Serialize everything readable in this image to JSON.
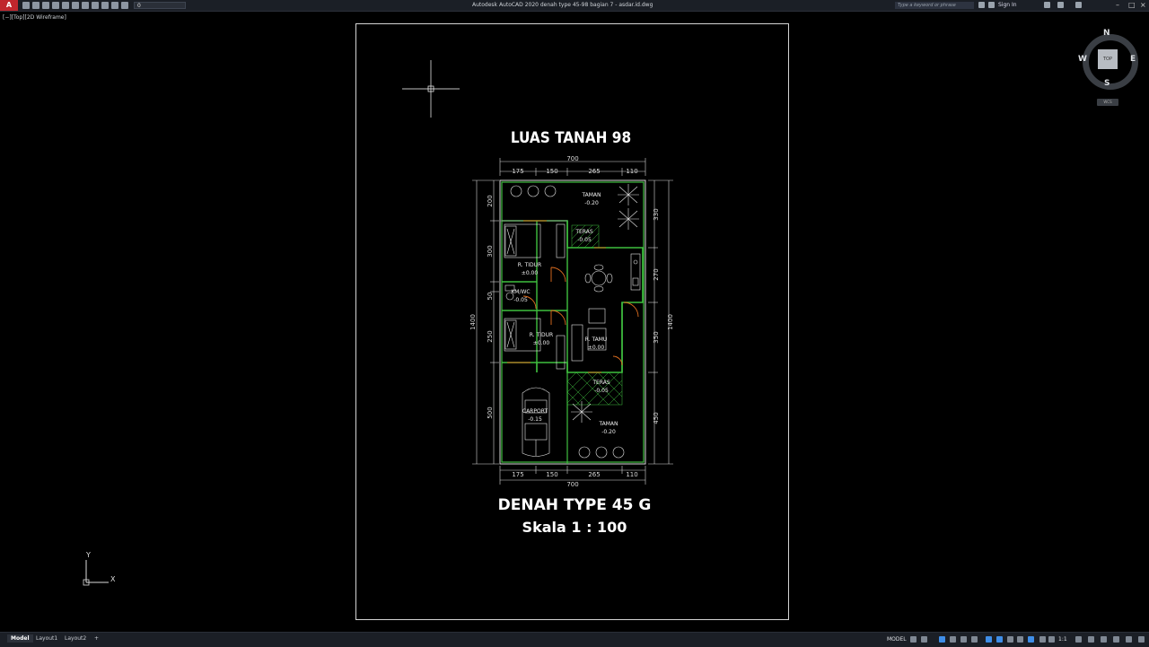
{
  "window": {
    "title": "Autodesk AutoCAD 2020    denah type 45-98 bagian 7 - asdar.id.dwg",
    "search_placeholder": "Type a keyword or phrase",
    "sign_in": "Sign In",
    "layer": "0",
    "logo": "A"
  },
  "viewport": {
    "label": "[−][Top][2D Wireframe]"
  },
  "compass": {
    "n": "N",
    "s": "S",
    "e": "E",
    "w": "W",
    "top": "TOP",
    "wcs": "WCS"
  },
  "ucs": {
    "x": "X",
    "y": "Y"
  },
  "drawing": {
    "title_top": "LUAS TANAH 98",
    "title_bottom": "DENAH TYPE 45 G",
    "scale": "Skala 1 : 100",
    "dims_top": [
      "700",
      "175",
      "150",
      "265",
      "110"
    ],
    "dims_bottom": [
      "175",
      "150",
      "265",
      "110",
      "700"
    ],
    "dims_left": [
      "200",
      "300",
      "50",
      "250",
      "500",
      "1400"
    ],
    "dims_right": [
      "330",
      "270",
      "350",
      "450",
      "1400"
    ],
    "rooms": [
      {
        "name": "TAMAN",
        "level": "-0.20"
      },
      {
        "name": "TERAS",
        "level": "-0.05"
      },
      {
        "name": "R. TIDUR",
        "level": "±0.00"
      },
      {
        "name": "KM/WC",
        "level": "-0.05"
      },
      {
        "name": "R. TIDUR",
        "level": "±0.00"
      },
      {
        "name": "R. TAMU",
        "level": "±0.00"
      },
      {
        "name": "TERAS",
        "level": "-0.05"
      },
      {
        "name": "CARPORT",
        "level": "-0.15"
      },
      {
        "name": "TAMAN",
        "level": "-0.20"
      }
    ]
  },
  "tabs": [
    "Model",
    "Layout1",
    "Layout2",
    "+"
  ],
  "status": {
    "model": "MODEL",
    "scale": "1:1"
  }
}
